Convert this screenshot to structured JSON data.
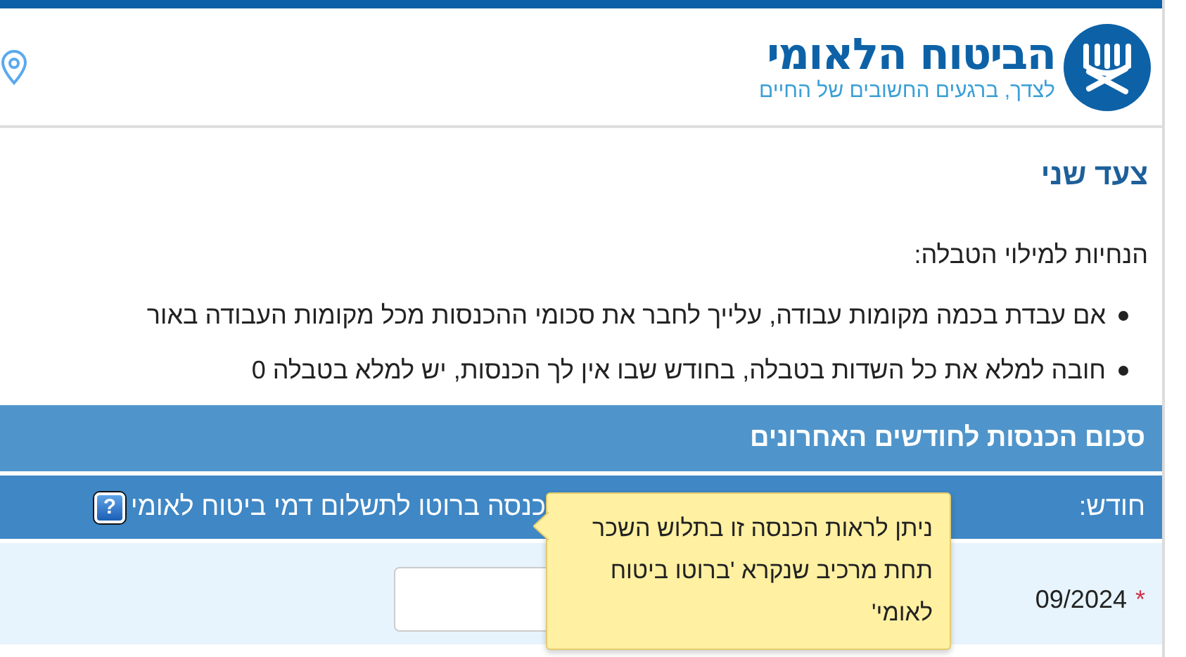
{
  "header": {
    "logo_title": "הביטוח הלאומי",
    "logo_tagline": "לצדך, ברגעים החשובים של החיים"
  },
  "step_title": "צעד שני",
  "instructions_title": "הנחיות למילוי הטבלה:",
  "instructions": [
    "אם עבדת בכמה מקומות עבודה, עלייך לחבר את סכומי ההכנסות מכל מקומות העבודה באור",
    "חובה למלא את כל השדות בטבלה, בחודש שבו אין לך הכנסות, יש למלא בטבלה 0"
  ],
  "table": {
    "title": "סכום הכנסות לחודשים האחרונים",
    "columns": [
      "חודש:",
      "כנסה ברוטו לתשלום דמי ביטוח לאומי"
    ],
    "help_button": "?",
    "rows": [
      {
        "month": "09/2024",
        "required_mark": "*"
      }
    ]
  },
  "tooltip": {
    "text": "ניתן לראות הכנסה זו בתלוש השכר תחת מרכיב שנקרא 'ברוטו ביטוח לאומי'"
  }
}
